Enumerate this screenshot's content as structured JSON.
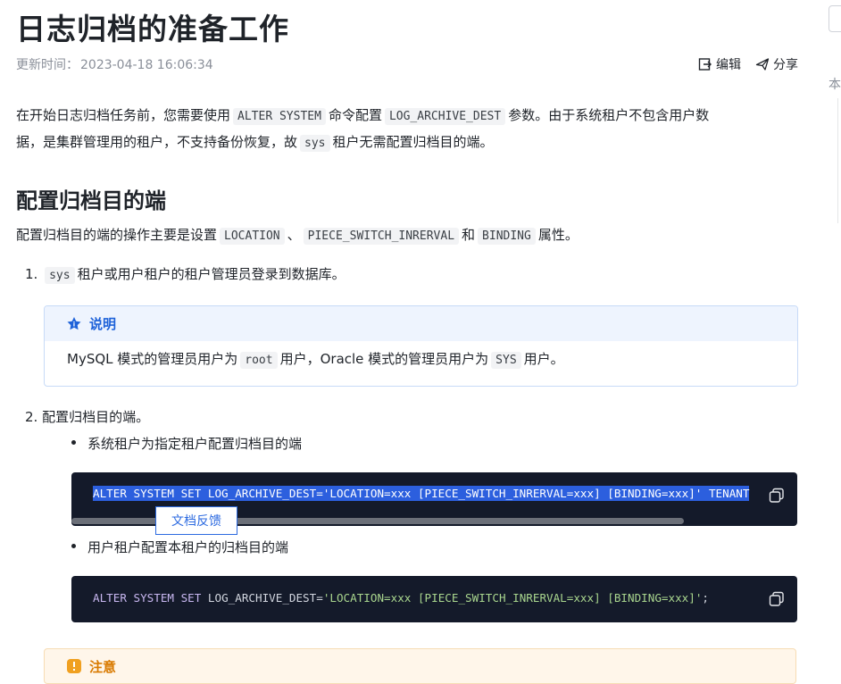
{
  "title": "日志归档的准备工作",
  "meta": {
    "updated_label": "更新时间：",
    "updated_value": "2023-04-18 16:06:34"
  },
  "actions": {
    "edit": "编辑",
    "share": "分享"
  },
  "intro": {
    "t1": "在开始日志归档任务前，您需要使用",
    "c1": "ALTER SYSTEM",
    "t2": "命令配置",
    "c2": "LOG_ARCHIVE_DEST",
    "t3": "参数。由于系统租户不包含用户数",
    "t4": "据，是集群管理用的租户，不支持备份恢复，故",
    "c3": "sys",
    "t5": "租户无需配置归档目的端。"
  },
  "section": {
    "heading": "配置归档目的端",
    "desc_t1": "配置归档目的端的操作主要是设置",
    "desc_c1": "LOCATION",
    "desc_sep": "、",
    "desc_c2": "PIECE_SWITCH_INRERVAL",
    "desc_t2": "和",
    "desc_c3": "BINDING",
    "desc_t3": "属性。"
  },
  "steps": [
    {
      "num": "1.",
      "code": "sys",
      "text": "租户或用户租户的租户管理员登录到数据库。"
    },
    {
      "num": "2.",
      "text": "配置归档目的端。"
    }
  ],
  "note": {
    "title": "说明",
    "t1": "MySQL 模式的管理员用户为",
    "c1": "root",
    "t2": "用户，Oracle 模式的管理员用户为",
    "c2": "SYS",
    "t3": "用户。"
  },
  "bullets": [
    {
      "text": "系统租户为指定租户配置归档目的端"
    },
    {
      "text": "用户租户配置本租户的归档目的端"
    }
  ],
  "code1": {
    "line": "ALTER SYSTEM SET LOG_ARCHIVE_DEST='LOCATION=xxx [PIECE_SWITCH_INRERVAL=xxx] [BINDING=xxx]' TENANT"
  },
  "code2": {
    "kw": "ALTER SYSTEM SET",
    "name": " LOG_ARCHIVE_DEST=",
    "str": "'LOCATION=xxx [PIECE_SWITCH_INRERVAL=xxx] [BINDING=xxx]'",
    "end": ";"
  },
  "feedback": "文档反馈",
  "caution": {
    "title": "注意"
  },
  "toc_label": "本",
  "colors": {
    "accent": "#1e62d9",
    "code_bg": "#141a2a",
    "selection": "#2c5fde",
    "caution": "#d97a00"
  }
}
